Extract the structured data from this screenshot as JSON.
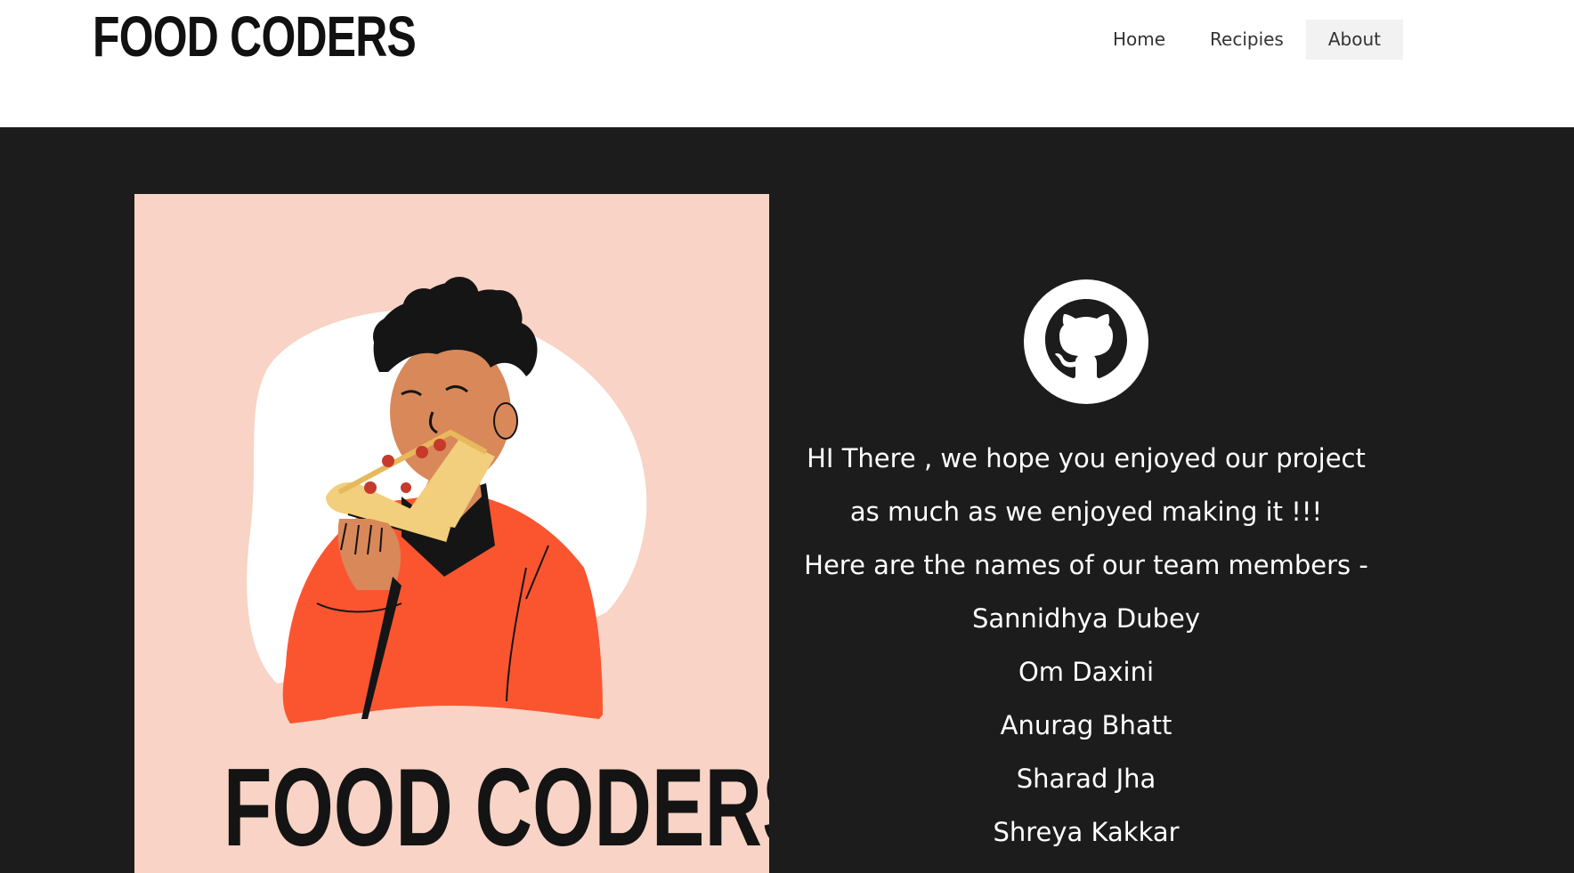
{
  "header": {
    "brand": "FOOD CODERS",
    "nav": [
      {
        "label": "Home",
        "active": false
      },
      {
        "label": "Recipies",
        "active": false
      },
      {
        "label": "About",
        "active": true
      }
    ]
  },
  "poster": {
    "title": "FOOD CODERS",
    "illustration": "man-eating-pizza",
    "background_color": "#f9d3c5"
  },
  "about": {
    "icon": "github-icon",
    "intro_line1": "HI There , we hope you enjoyed our project",
    "intro_line2": "as much as we enjoyed making it !!!",
    "team_heading": "Here are the names of our team members -",
    "team_members": [
      "Sannidhya Dubey",
      "Om Daxini",
      "Anurag Bhatt",
      "Sharad Jha",
      "Shreya Kakkar"
    ]
  },
  "colors": {
    "page_background": "#1c1c1c",
    "header_background": "#ffffff",
    "sweater": "#fb5530",
    "skin": "#d9885a"
  }
}
